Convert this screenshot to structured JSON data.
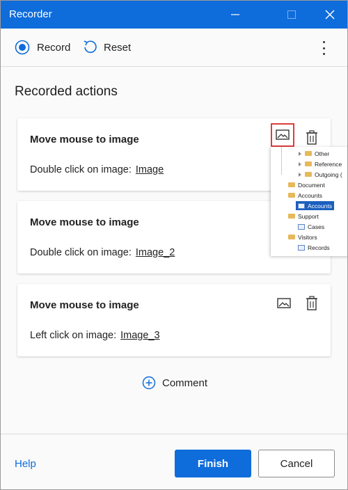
{
  "window": {
    "title": "Recorder"
  },
  "toolbar": {
    "record_label": "Record",
    "reset_label": "Reset"
  },
  "heading": "Recorded actions",
  "actions": [
    {
      "title": "Move mouse to image",
      "desc": "Double click on image:",
      "link": "Image"
    },
    {
      "title": "Move mouse to image",
      "desc": "Double click on image:",
      "link": "Image_2"
    },
    {
      "title": "Move mouse to image",
      "desc": "Left click on image:",
      "link": "Image_3"
    }
  ],
  "preview": {
    "items": [
      "Other",
      "Reference",
      "Outgoing (",
      "Document",
      "Accounts",
      "Accounts",
      "Support",
      "Cases",
      "Visitors",
      "Records"
    ]
  },
  "comment_label": "Comment",
  "footer": {
    "help_label": "Help",
    "finish_label": "Finish",
    "cancel_label": "Cancel"
  },
  "colors": {
    "accent": "#0f6cdb",
    "highlight": "#e03c3c"
  }
}
